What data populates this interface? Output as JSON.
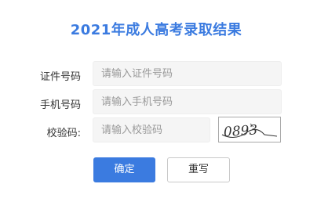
{
  "title": "2021年成人高考录取结果",
  "form": {
    "id_label": "证件号码",
    "id_placeholder": "请输入证件号码",
    "phone_label": "手机号码",
    "phone_placeholder": "请输入手机号码",
    "captcha_label": "校验码:",
    "captcha_placeholder": "请输入校验码",
    "captcha_text": "0893"
  },
  "buttons": {
    "confirm": "确定",
    "reset": "重写"
  },
  "colors": {
    "accent": "#3b7be0",
    "input_bg": "#f5f5f5"
  }
}
